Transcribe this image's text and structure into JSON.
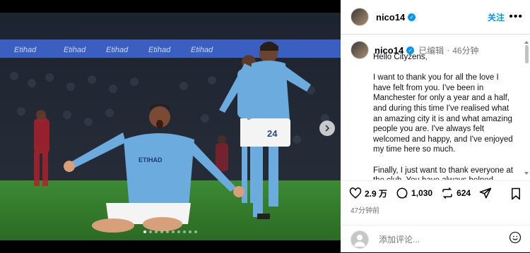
{
  "post": {
    "username": "nico14",
    "follow_label": "关注",
    "more_label": "•••",
    "edited_label": "已编辑",
    "edited_time": "46分钟",
    "caption": "Hello Cityzens,\n\nI want to thank you for all the love I have felt from you. I've been in Manchester for only a year and a half, and during this time I've realised what an amazing city it is and what amazing people you are. I've always felt welcomed and happy, and I've enjoyed my time here so much.\n\nFinally, I just want to thank everyone at the club. You have always helped",
    "likes": "2.9 万",
    "comments": "1,030",
    "reposts": "624",
    "time_ago": "47分钟前",
    "comment_placeholder": "添加评论..."
  },
  "photo": {
    "ad_board_text": "Etihad",
    "shirt_text": "ETIHAD",
    "shirt_number": "24",
    "carousel_total": 10,
    "carousel_active": 0
  },
  "icons": {
    "verified": "verified-badge-icon",
    "like": "heart-icon",
    "comment": "comment-bubble-icon",
    "repost": "repost-icon",
    "share": "send-icon",
    "save": "bookmark-icon",
    "emoji": "emoji-icon",
    "next": "chevron-right-icon"
  },
  "colors": {
    "accent": "#0095f6",
    "sky_blue": "#6cabdd",
    "pitch": "#2f7d2a"
  }
}
